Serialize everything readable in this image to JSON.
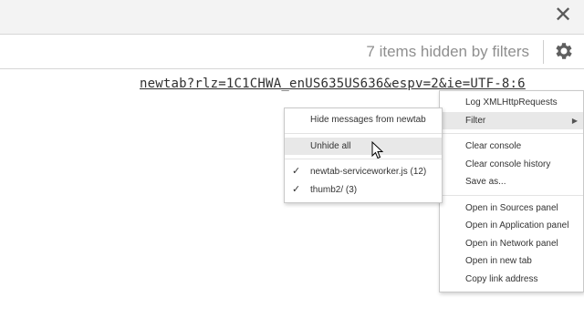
{
  "toolbar": {
    "close_icon": "close-icon",
    "hidden_count_text": "7 items hidden by filters",
    "settings_icon": "gear-icon"
  },
  "console": {
    "link_text": "newtab?rlz=1C1CHWA_enUS635US636&espv=2&ie=UTF-8:6"
  },
  "context_menu": {
    "items": [
      {
        "label": "Log XMLHttpRequests"
      },
      {
        "label": "Filter",
        "has_submenu": true
      },
      {
        "label": "Clear console"
      },
      {
        "label": "Clear console history"
      },
      {
        "label": "Save as..."
      },
      {
        "label": "Open in Sources panel"
      },
      {
        "label": "Open in Application panel"
      },
      {
        "label": "Open in Network panel"
      },
      {
        "label": "Open in new tab"
      },
      {
        "label": "Copy link address"
      }
    ]
  },
  "filter_submenu": {
    "items": [
      {
        "label": "Hide messages from newtab"
      },
      {
        "label": "Unhide all"
      },
      {
        "label": "newtab-serviceworker.js (12)",
        "checked": true
      },
      {
        "label": "thumb2/ (3)",
        "checked": true
      }
    ]
  },
  "colors": {
    "hover_background": "#e8e8e8",
    "toolbar_background": "#f3f3f3"
  }
}
